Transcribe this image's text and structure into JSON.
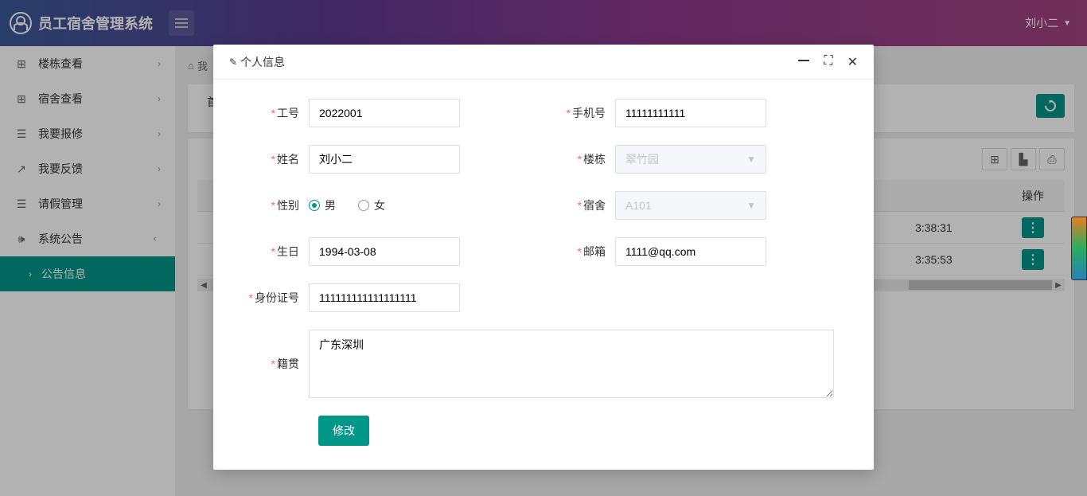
{
  "app": {
    "title": "员工宿舍管理系统",
    "username": "刘小二"
  },
  "sidebar": {
    "items": [
      {
        "label": "楼栋查看",
        "icon": "grid"
      },
      {
        "label": "宿舍查看",
        "icon": "grid"
      },
      {
        "label": "我要报修",
        "icon": "doc"
      },
      {
        "label": "我要反馈",
        "icon": "share"
      },
      {
        "label": "请假管理",
        "icon": "doc"
      },
      {
        "label": "系统公告",
        "icon": "sound",
        "expanded": true
      }
    ],
    "sub_label": "公告信息"
  },
  "breadcrumb": {
    "home": "我"
  },
  "tabs": {
    "first": "首"
  },
  "table": {
    "col_action": "操作",
    "rows": [
      {
        "time": "3:38:31"
      },
      {
        "time": "3:35:53"
      }
    ]
  },
  "modal": {
    "title": "个人信息",
    "labels": {
      "employee_id": "工号",
      "name": "姓名",
      "gender": "性别",
      "birthday": "生日",
      "id_card": "身份证号",
      "native": "籍贯",
      "phone": "手机号",
      "building": "楼栋",
      "dorm": "宿舍",
      "email": "邮箱"
    },
    "values": {
      "employee_id": "2022001",
      "name": "刘小二",
      "birthday": "1994-03-08",
      "id_card": "111111111111111111",
      "native": "广东深圳",
      "phone": "11111111111",
      "building": "翠竹园",
      "dorm": "A101",
      "email": "1111@qq.com"
    },
    "gender_options": {
      "male": "男",
      "female": "女"
    },
    "submit": "修改"
  }
}
